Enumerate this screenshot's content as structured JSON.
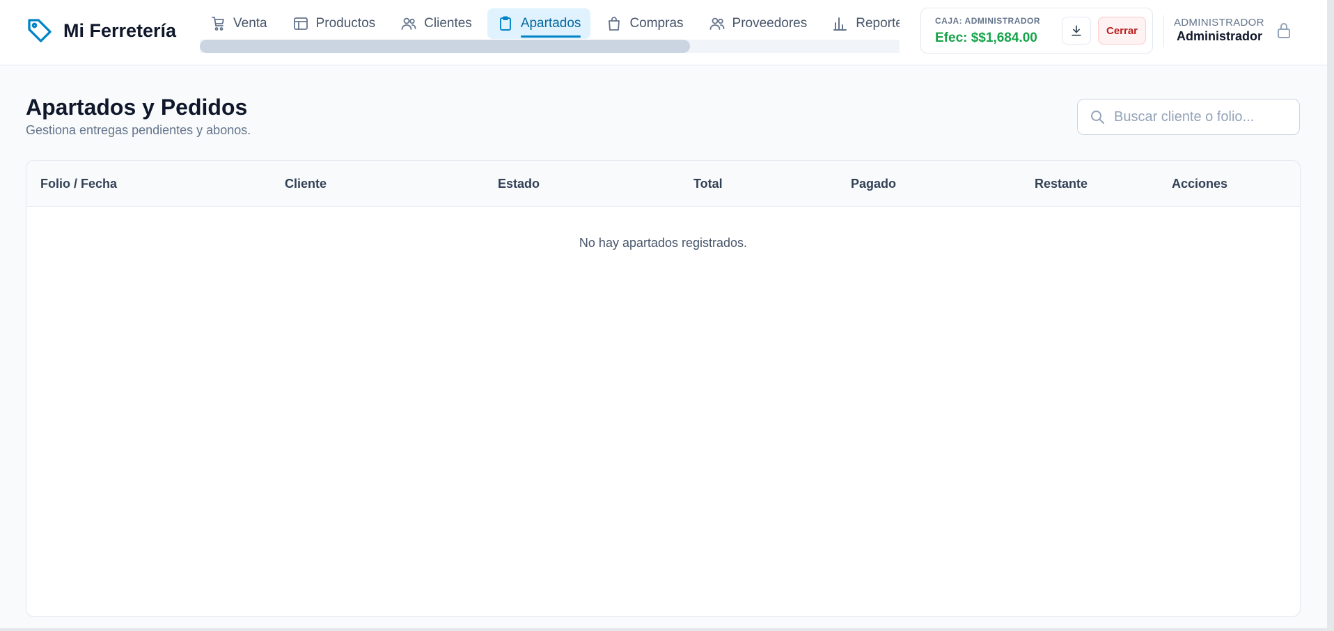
{
  "app": {
    "title": "Mi Ferretería",
    "brand_icon": "tag-icon",
    "accent": "#0284c7"
  },
  "nav": {
    "items": [
      {
        "label": "Venta",
        "icon": "cart-icon",
        "active": false
      },
      {
        "label": "Productos",
        "icon": "layout-icon",
        "active": false
      },
      {
        "label": "Clientes",
        "icon": "users-icon",
        "active": false
      },
      {
        "label": "Apartados",
        "icon": "clipboard-icon",
        "active": true
      },
      {
        "label": "Compras",
        "icon": "bag-icon",
        "active": false
      },
      {
        "label": "Proveedores",
        "icon": "users-icon",
        "active": false
      },
      {
        "label": "Reportes",
        "icon": "bar-chart-icon",
        "active": false
      }
    ],
    "scroll_position": 0.7
  },
  "caja": {
    "label": "CAJA: ADMINISTRADOR",
    "value": "Efec: $$1,684.00",
    "download_icon": "download-icon",
    "close_label": "Cerrar",
    "value_color": "#16a34a"
  },
  "user": {
    "role": "ADMINISTRADOR",
    "name": "Administrador",
    "lock_icon": "lock-icon"
  },
  "page": {
    "title": "Apartados y Pedidos",
    "subtitle": "Gestiona entregas pendientes y abonos."
  },
  "search": {
    "placeholder": "Buscar cliente o folio...",
    "value": ""
  },
  "table": {
    "columns": [
      "Folio / Fecha",
      "Cliente",
      "Estado",
      "Total",
      "Pagado",
      "Restante",
      "Acciones"
    ],
    "rows": [],
    "empty_message": "No hay apartados registrados."
  }
}
